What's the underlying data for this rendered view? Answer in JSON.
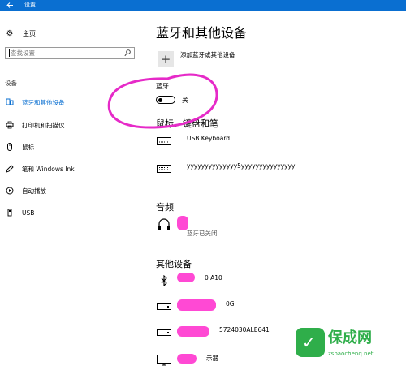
{
  "window": {
    "title": "设置"
  },
  "sidebar": {
    "home_label": "主页",
    "search_placeholder": "查找设置",
    "section_label": "设备",
    "items": [
      {
        "label": "蓝牙和其他设备",
        "icon": "bluetooth-devices-icon",
        "active": true
      },
      {
        "label": "打印机和扫描仪",
        "icon": "printer-icon",
        "active": false
      },
      {
        "label": "鼠标",
        "icon": "mouse-icon",
        "active": false
      },
      {
        "label": "笔和 Windows Ink",
        "icon": "pen-icon",
        "active": false
      },
      {
        "label": "自动播放",
        "icon": "autoplay-icon",
        "active": false
      },
      {
        "label": "USB",
        "icon": "usb-icon",
        "active": false
      }
    ]
  },
  "main": {
    "title": "蓝牙和其他设备",
    "add_device_label": "添加蓝牙或其他设备",
    "bluetooth": {
      "label": "蓝牙",
      "state_label": "关",
      "on": false
    },
    "sections": {
      "mouse_keyboard_pen": "鼠标、键盘和笔",
      "audio": "音频",
      "other_devices": "其他设备"
    },
    "mouse_keyboard_devices": [
      {
        "name": "USB Keyboard",
        "icon": "keyboard-icon"
      },
      {
        "name": "yyyyyyyyyyyyyy5yyyyyyyyyyyyyyy",
        "icon": "keyboard-icon"
      }
    ],
    "audio_devices": [
      {
        "name": "",
        "status": "蓝牙已关闭",
        "icon": "headset-icon"
      }
    ],
    "other_devices": [
      {
        "name": "0 A10",
        "icon": "bluetooth-icon"
      },
      {
        "name": "0G",
        "icon": "drive-icon"
      },
      {
        "name": "5724030ALE641",
        "icon": "drive-icon"
      },
      {
        "name": "示器",
        "icon": "monitor-icon"
      }
    ]
  },
  "watermark": {
    "brand": "保成网",
    "url": "zsbaochenq.net",
    "color": "#2fae4a"
  },
  "colors": {
    "accent": "#0a6fd1",
    "annotation": "#e62ac8",
    "blot": "#ff3fd2"
  }
}
